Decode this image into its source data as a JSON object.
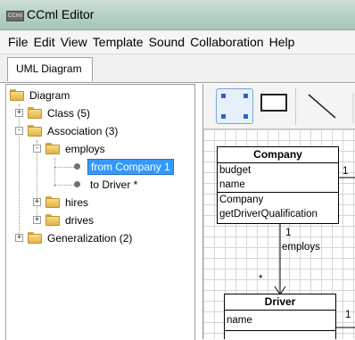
{
  "window": {
    "title": "CCml Editor",
    "icon_text": "CCml"
  },
  "menu": [
    "File",
    "Edit",
    "View",
    "Template",
    "Sound",
    "Collaboration",
    "Help"
  ],
  "tabs": [
    {
      "label": "UML Diagram"
    }
  ],
  "tree": {
    "root": "Diagram",
    "class": "Class (5)",
    "association": "Association (3)",
    "employs": "employs",
    "from": "from Company 1",
    "to": "to Driver *",
    "hires": "hires",
    "drives": "drives",
    "generalization": "Generalization (2)"
  },
  "diagram": {
    "company": {
      "name": "Company",
      "attributes": [
        "budget",
        "name"
      ],
      "operations": [
        "Company",
        "getDriverQualification"
      ]
    },
    "driver": {
      "name": "Driver",
      "attributes": [
        "name"
      ]
    },
    "association": {
      "label": "employs",
      "source_mult": "1",
      "target_mult": "*"
    },
    "side_labels": {
      "company_right": "1",
      "driver_right": "1"
    }
  },
  "colors": {
    "selection": "#3399ff",
    "folder": "#e3b448",
    "title_bar": "#b7d2c4"
  }
}
